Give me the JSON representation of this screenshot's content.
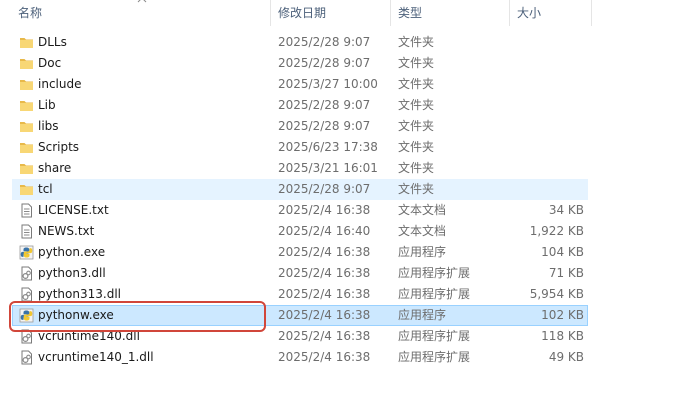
{
  "header": {
    "name": "名称",
    "date_modified": "修改日期",
    "type": "类型",
    "size": "大小"
  },
  "colors": {
    "folder": "#f8d775",
    "selected_bg": "#cce8ff",
    "hover_bg": "#e5f3ff",
    "annotation": "#d1463a"
  },
  "files": [
    {
      "name": "DLLs",
      "date": "2025/2/28 9:07",
      "type": "文件夹",
      "size": "",
      "icon": "folder-icon"
    },
    {
      "name": "Doc",
      "date": "2025/2/28 9:07",
      "type": "文件夹",
      "size": "",
      "icon": "folder-icon"
    },
    {
      "name": "include",
      "date": "2025/3/27 10:00",
      "type": "文件夹",
      "size": "",
      "icon": "folder-icon"
    },
    {
      "name": "Lib",
      "date": "2025/2/28 9:07",
      "type": "文件夹",
      "size": "",
      "icon": "folder-icon"
    },
    {
      "name": "libs",
      "date": "2025/2/28 9:07",
      "type": "文件夹",
      "size": "",
      "icon": "folder-icon"
    },
    {
      "name": "Scripts",
      "date": "2025/6/23 17:38",
      "type": "文件夹",
      "size": "",
      "icon": "folder-icon"
    },
    {
      "name": "share",
      "date": "2025/3/21 16:01",
      "type": "文件夹",
      "size": "",
      "icon": "folder-icon"
    },
    {
      "name": "tcl",
      "date": "2025/2/28 9:07",
      "type": "文件夹",
      "size": "",
      "icon": "folder-icon"
    },
    {
      "name": "LICENSE.txt",
      "date": "2025/2/4 16:38",
      "type": "文本文档",
      "size": "34 KB",
      "icon": "text-file-icon"
    },
    {
      "name": "NEWS.txt",
      "date": "2025/2/4 16:40",
      "type": "文本文档",
      "size": "1,922 KB",
      "icon": "text-file-icon"
    },
    {
      "name": "python.exe",
      "date": "2025/2/4 16:38",
      "type": "应用程序",
      "size": "104 KB",
      "icon": "python-exe-icon"
    },
    {
      "name": "python3.dll",
      "date": "2025/2/4 16:38",
      "type": "应用程序扩展",
      "size": "71 KB",
      "icon": "dll-file-icon"
    },
    {
      "name": "python313.dll",
      "date": "2025/2/4 16:38",
      "type": "应用程序扩展",
      "size": "5,954 KB",
      "icon": "dll-file-icon"
    },
    {
      "name": "pythonw.exe",
      "date": "2025/2/4 16:38",
      "type": "应用程序",
      "size": "102 KB",
      "icon": "python-exe-icon"
    },
    {
      "name": "vcruntime140.dll",
      "date": "2025/2/4 16:38",
      "type": "应用程序扩展",
      "size": "118 KB",
      "icon": "dll-file-icon"
    },
    {
      "name": "vcruntime140_1.dll",
      "date": "2025/2/4 16:38",
      "type": "应用程序扩展",
      "size": "49 KB",
      "icon": "dll-file-icon"
    }
  ]
}
